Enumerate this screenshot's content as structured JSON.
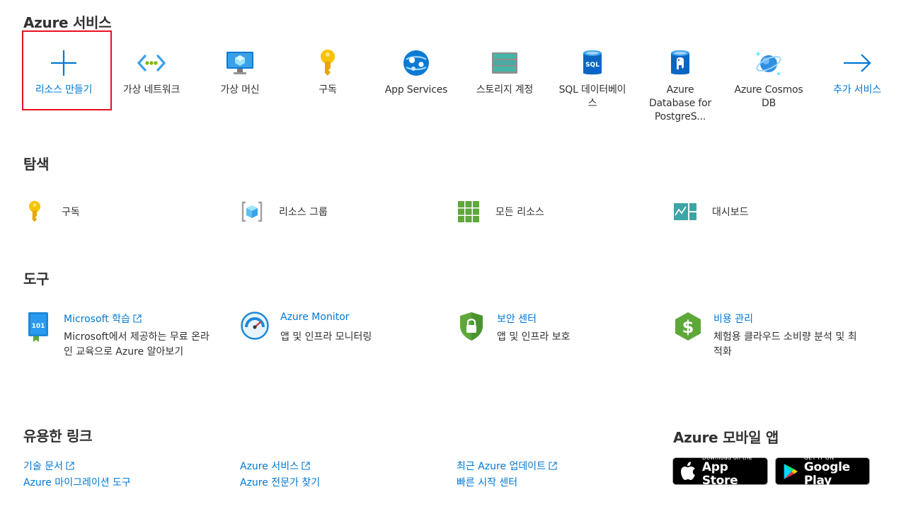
{
  "sections": {
    "services_title": "Azure 서비스",
    "navigate_title": "탐색",
    "tools_title": "도구",
    "links_title": "유용한 링크",
    "mobile_title": "Azure 모바일 앱"
  },
  "services": [
    {
      "label": "리소스 만들기",
      "icon": "plus-icon"
    },
    {
      "label": "가상 네트워크",
      "icon": "virtual-network-icon"
    },
    {
      "label": "가상 머신",
      "icon": "virtual-machine-icon"
    },
    {
      "label": "구독",
      "icon": "key-icon"
    },
    {
      "label": "App Services",
      "icon": "app-services-icon"
    },
    {
      "label": "스토리지 계정",
      "icon": "storage-account-icon"
    },
    {
      "label": "SQL 데이터베이스",
      "icon": "sql-database-icon"
    },
    {
      "label": "Azure Database for PostgreS...",
      "icon": "postgresql-icon"
    },
    {
      "label": "Azure Cosmos DB",
      "icon": "cosmos-db-icon"
    },
    {
      "label": "추가 서비스",
      "icon": "arrow-right-icon"
    }
  ],
  "navigate": [
    {
      "label": "구독",
      "icon": "key-icon"
    },
    {
      "label": "리소스 그룹",
      "icon": "resource-group-icon"
    },
    {
      "label": "모든 리소스",
      "icon": "all-resources-icon"
    },
    {
      "label": "대시보드",
      "icon": "dashboard-icon"
    }
  ],
  "tools": [
    {
      "title": "Microsoft 학습",
      "desc": "Microsoft에서 제공하는 무료 온라인 교육으로 Azure 알아보기",
      "icon": "learn-book-icon"
    },
    {
      "title": "Azure Monitor",
      "desc": "앱 및 인프라 모니터링",
      "icon": "monitor-gauge-icon"
    },
    {
      "title": "보안 센터",
      "desc": "앱 및 인프라 보호",
      "icon": "security-shield-icon"
    },
    {
      "title": "비용 관리",
      "desc": "체험용 클라우드 소비량 분석 및 최적화",
      "icon": "cost-management-icon"
    }
  ],
  "links": {
    "tech_docs": "기술 문서",
    "azure_migration": "Azure 마이그레이션 도구",
    "azure_services": "Azure 서비스",
    "find_expert": "Azure 전문가 찾기",
    "recent_updates": "최근 Azure 업데이트",
    "quickstart": "빠른 시작 센터"
  },
  "stores": {
    "apple_small": "Download on the",
    "apple_big": "App Store",
    "google_small": "GET IT ON",
    "google_big": "Google Play"
  },
  "colors": {
    "accent": "#0078d4",
    "highlight": "#e81123"
  }
}
